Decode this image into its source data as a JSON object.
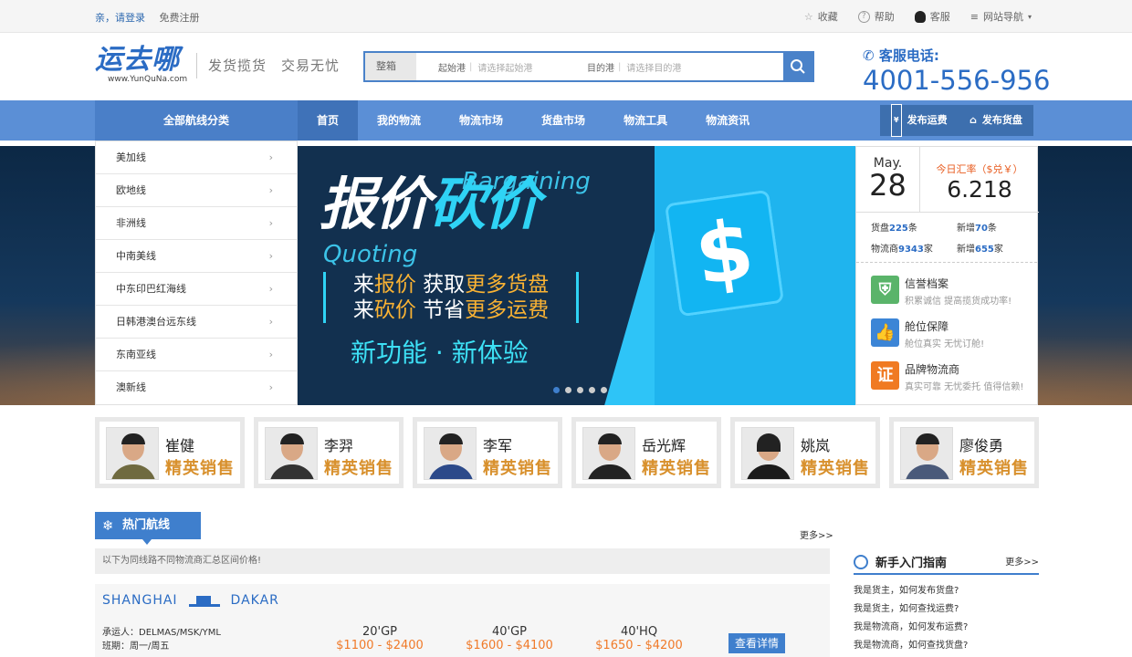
{
  "topbar": {
    "login": "亲，请登录",
    "register": "免费注册",
    "links": [
      "收藏",
      "帮助",
      "客服",
      "网站导航"
    ]
  },
  "header": {
    "logo_cn": "运去哪",
    "logo_en": "www.YunQuNa.com",
    "slogan": "发货揽货　交易无忧",
    "search": {
      "category": "整箱",
      "from_label": "起始港",
      "from_placeholder": "请选择起始港",
      "to_label": "目的港",
      "to_placeholder": "请选择目的港"
    },
    "hotline_label": "客服电话:",
    "hotline": "4001-556-956"
  },
  "nav": {
    "all_category": "全部航线分类",
    "items": [
      "首页",
      "我的物流",
      "物流市场",
      "货盘市场",
      "物流工具",
      "物流资讯"
    ],
    "publish_freight": "发布运费",
    "publish_cargo": "发布货盘"
  },
  "categories": [
    "美加线",
    "欧地线",
    "非洲线",
    "中南美线",
    "中东印巴红海线",
    "日韩港澳台远东线",
    "东南亚线",
    "澳新线"
  ],
  "banner": {
    "title1": "报价",
    "title2": "砍价",
    "en1": "Bargaining",
    "en2": "Quoting",
    "line1": [
      "来",
      "报价",
      "  获取",
      "更多货盘"
    ],
    "line2": [
      "来",
      "砍价",
      "  节省",
      "更多运费"
    ],
    "tagline": "新功能 · 新体验",
    "symbol": "$"
  },
  "side": {
    "month": "May.",
    "day": "28",
    "rate_label": "今日汇率（$兑￥）",
    "rate": "6.218",
    "stats": {
      "cargo_label": "货盘",
      "cargo": "225",
      "cargo_unit": "条",
      "new_label": "新增",
      "new1": "70",
      "new1_unit": "条",
      "forwarder_label": "物流商",
      "forwarder": "9343",
      "forwarder_unit": "家",
      "new2": "655",
      "new2_unit": "家"
    },
    "features": [
      {
        "title": "信誉档案",
        "sub": "积累诚信 提高揽货成功率!",
        "color": "#5ab46a"
      },
      {
        "title": "舱位保障",
        "sub": "舱位真实 无忧订舱!",
        "color": "#3c85d6"
      },
      {
        "title": "品牌物流商",
        "sub": "真实可靠 无忧委托 值得信赖!",
        "color": "#f07a22",
        "icon_text": "证"
      }
    ]
  },
  "sales": [
    {
      "name": "崔健",
      "title": "精英销售"
    },
    {
      "name": "李羿",
      "title": "精英销售"
    },
    {
      "name": "李军",
      "title": "精英销售"
    },
    {
      "name": "岳光辉",
      "title": "精英销售"
    },
    {
      "name": "姚岚",
      "title": "精英销售"
    },
    {
      "name": "廖俊勇",
      "title": "精英销售"
    }
  ],
  "hot": {
    "title": "热门航线",
    "more": "更多>>",
    "desc": "以下为同线路不同物流商汇总区间价格!",
    "route": {
      "from": "SHANGHAI",
      "to": "DAKAR",
      "carrier": "承运人：DELMAS/MSK/YML",
      "schedule": "班期：周一/周五",
      "prices": [
        {
          "type": "20'GP",
          "range": "$1100 - $2400"
        },
        {
          "type": "40'GP",
          "range": "$1600 - $4100"
        },
        {
          "type": "40'HQ",
          "range": "$1650 - $4200"
        }
      ],
      "detail": "查看详情"
    }
  },
  "guide": {
    "title": "新手入门指南",
    "more": "更多>>",
    "items": [
      "我是货主，如何发布货盘?",
      "我是货主，如何查找运费?",
      "我是物流商，如何发布运费?",
      "我是物流商，如何查找货盘?"
    ]
  },
  "colors": {
    "brand": "#2b6cc4",
    "nav": "#5b8fd6",
    "accent": "#f07a29",
    "gold": "#d8902c"
  }
}
